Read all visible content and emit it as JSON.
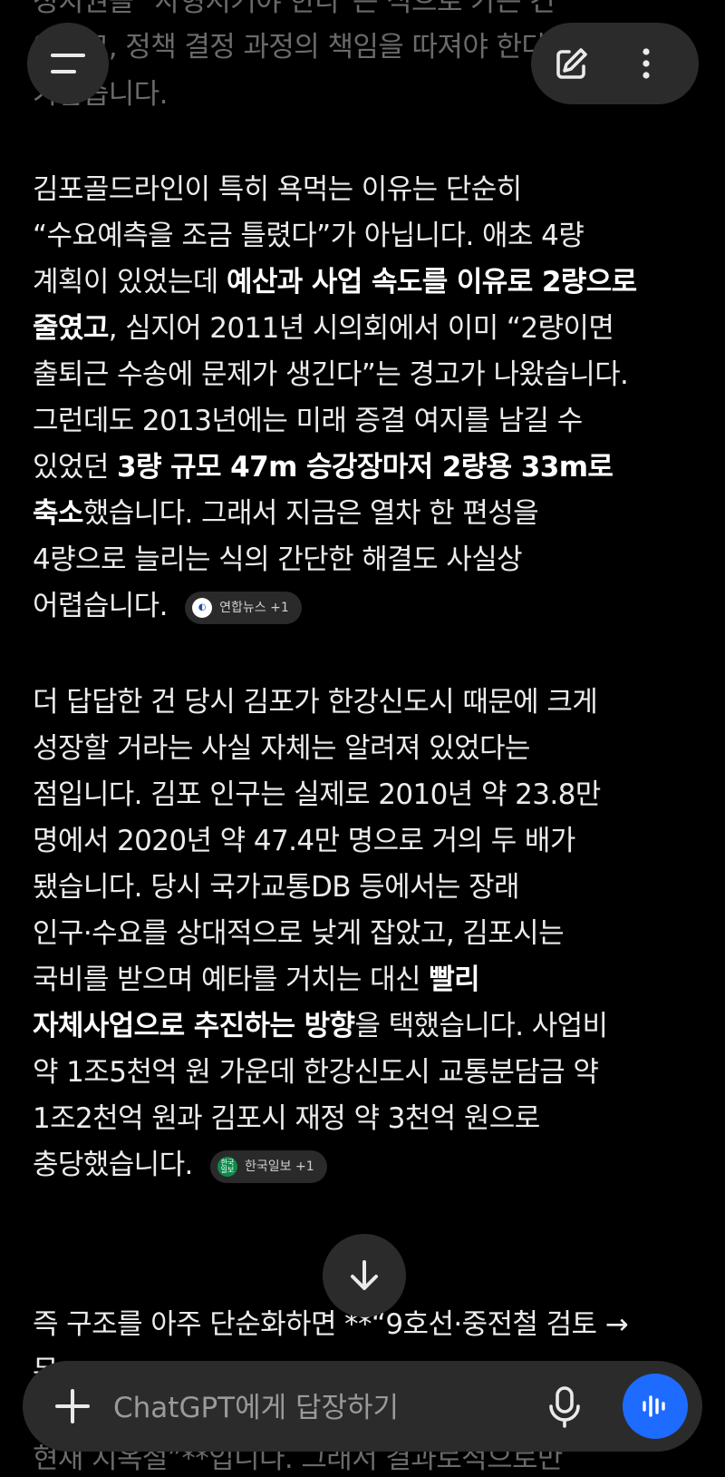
{
  "top_bar": {
    "menu_icon": "hamburger-icon",
    "edit_icon": "edit-icon",
    "more_icon": "more-vertical-icon"
  },
  "message": {
    "partial_top": [
      "정치권을 \"사형지거야 한다\"는 식으로 가는 건",
      "아니고, 정책 결정 과정의 책임을 따져야 한다는",
      "가깝습니다."
    ],
    "p1": {
      "l1": "김포골드라인이 특히 욕먹는 이유는 단순히",
      "l2": "“수요예측을 조금 틀렸다”가 아닙니다. 애초 4량",
      "l3a": "계획이 있었는데 ",
      "l3b": "예산과 사업 속도를 이유로 2량으로",
      "l4a": "줄였고",
      "l4b": ", 심지어 2011년 시의회에서 이미 “2량이면",
      "l5": "출퇴근 수송에 문제가 생긴다”는 경고가 나왔습니다.",
      "l6": "그런데도 2013년에는 미래 증결 여지를 남길 수",
      "l7a": "있었던 ",
      "l7b": "3량 규모 47m 승강장마저 2량용 33m로",
      "l8a": "축소",
      "l8b": "했습니다. 그래서 지금은 열차 한 편성을",
      "l9": "4량으로 늘리는 식의 간단한 해결도 사실상",
      "l10": "어렵습니다.",
      "chip_label": "연합뉴스 +1"
    },
    "p2": {
      "l1": "더 답답한 건 당시 김포가 한강신도시 때문에 크게",
      "l2": "성장할 거라는 사실 자체는 알려져 있었다는",
      "l3": "점입니다. 김포 인구는 실제로 2010년 약 23.8만",
      "l4": "명에서 2020년 약 47.4만 명으로 거의 두 배가",
      "l5": "됐습니다. 당시 국가교통DB 등에서는 장래",
      "l6": "인구·수요를 상대적으로 낮게 잡았고, 김포시는",
      "l7a": "국비를 받으며 예타를 거치는 대신 ",
      "l7b": "빨리",
      "l8a": "자체사업으로 추진하는 방향",
      "l8b": "을 택했습니다. 사업비",
      "l9": "약 1조5천억 원 가운데 한강신도시 교통분담금 약",
      "l10": "1조2천억 원과 김포시 재정 약 3천억 원으로",
      "l11": "충당했습니다.",
      "chip_label": "한국일보 +1"
    },
    "p3": {
      "l1": "즉 구조를 아주 단순화하면 **“9호선·중전철 검토 →",
      "l2": "무",
      "l_bottom": "현재 지옥철”**입니다. 그래서 결과로적으로만"
    }
  },
  "composer": {
    "placeholder": "ChatGPT에게 답장하기",
    "plus_icon": "plus-icon",
    "mic_icon": "microphone-icon",
    "voice_icon": "voice-waveform-icon"
  }
}
